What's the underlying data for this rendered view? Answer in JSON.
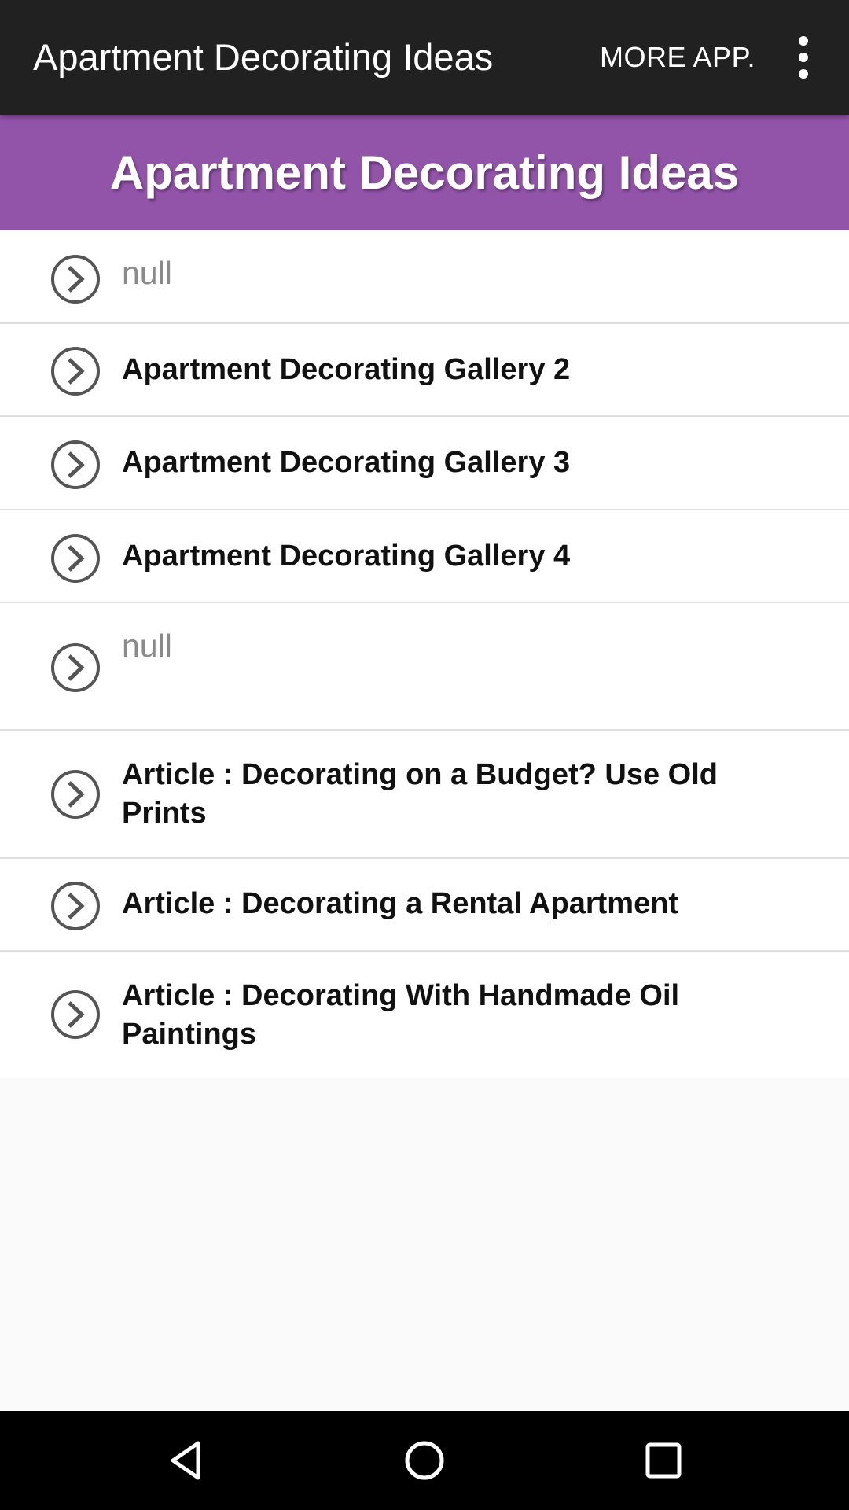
{
  "action_bar": {
    "title": "Apartment Decorating Ideas",
    "more_label": "MORE APP.",
    "overflow_icon": "more-vert-icon"
  },
  "banner": {
    "title": "Apartment Decorating Ideas"
  },
  "list": {
    "items": [
      {
        "label": "null",
        "is_null": true
      },
      {
        "label": "Apartment Decorating Gallery 2",
        "is_null": false
      },
      {
        "label": "Apartment Decorating Gallery 3",
        "is_null": false
      },
      {
        "label": "Apartment Decorating Gallery 4",
        "is_null": false
      },
      {
        "label": "null",
        "is_null": true
      },
      {
        "label": "Article : Decorating on a Budget? Use Old Prints",
        "is_null": false
      },
      {
        "label": "Article : Decorating a Rental Apartment",
        "is_null": false
      },
      {
        "label": "Article : Decorating With Handmade Oil Paintings",
        "is_null": false
      }
    ],
    "item_icon": "chevron-circle-right-icon"
  },
  "nav_bar": {
    "back_icon": "back-icon",
    "home_icon": "home-icon",
    "recents_icon": "recents-icon"
  },
  "colors": {
    "action_bar": "#212121",
    "banner": "#9254a9",
    "nav_bar": "#000000"
  }
}
